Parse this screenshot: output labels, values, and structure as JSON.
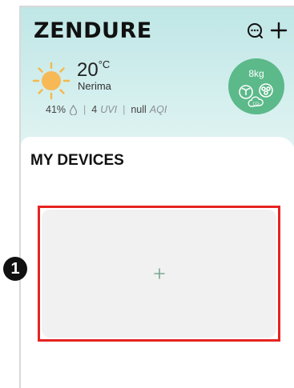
{
  "header": {
    "logo": "ZENDURE",
    "icons": [
      "chat-search-icon",
      "add-icon"
    ]
  },
  "weather": {
    "icon": "sun-icon",
    "temperature": "20",
    "unit": "°C",
    "city": "Nerima",
    "humidity": "41%",
    "uvi_value": "4",
    "uvi_label": "UVI",
    "aqi_value": "null",
    "aqi_label": "AQI"
  },
  "eco_badge": {
    "weight": "8kg",
    "icons": [
      "sprout-icon",
      "recycle-icon",
      "co2-cloud-icon"
    ],
    "color": "#5cb98a"
  },
  "devices": {
    "title": "MY DEVICES",
    "add_card_icon": "plus-icon"
  },
  "annotation": {
    "number": "1",
    "highlight_color": "#e52421"
  }
}
